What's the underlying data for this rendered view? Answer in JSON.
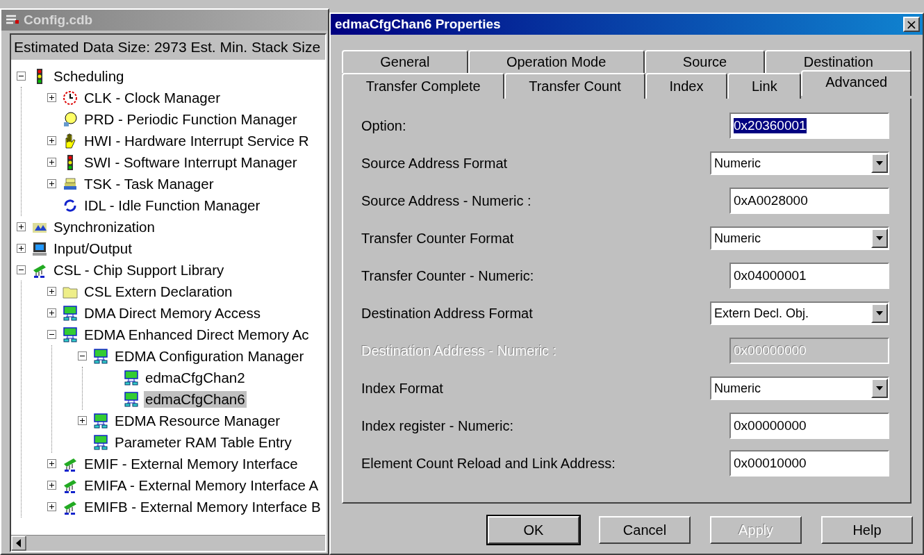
{
  "main_window": {
    "title": "Config.cdb",
    "status": "Estimated Data Size: 2973   Est. Min. Stack Size",
    "tree": [
      {
        "label": "Scheduling",
        "kind": "traffic",
        "expanded": true,
        "selected": false,
        "children": [
          {
            "label": "CLK - Clock Manager",
            "kind": "clock",
            "expanded": false,
            "selected": false
          },
          {
            "label": "PRD - Periodic Function Manager",
            "kind": "bulb",
            "selected": false
          },
          {
            "label": "HWI - Hardware Interrupt Service R",
            "kind": "hand",
            "expanded": false,
            "selected": false
          },
          {
            "label": "SWI - Software Interrupt Manager",
            "kind": "traffic",
            "expanded": false,
            "selected": false
          },
          {
            "label": "TSK - Task Manager",
            "kind": "books",
            "expanded": false,
            "selected": false
          },
          {
            "label": "IDL - Idle Function Manager",
            "kind": "cycle",
            "selected": false
          }
        ]
      },
      {
        "label": "Synchronization",
        "kind": "sync",
        "expanded": false,
        "selected": false
      },
      {
        "label": "Input/Output",
        "kind": "computer",
        "expanded": false,
        "selected": false
      },
      {
        "label": "CSL - Chip Support Library",
        "kind": "chip",
        "expanded": true,
        "selected": false,
        "children": [
          {
            "label": "CSL Extern Declaration",
            "kind": "folder",
            "expanded": false,
            "selected": false
          },
          {
            "label": "DMA Direct Memory Access",
            "kind": "board",
            "expanded": false,
            "selected": false
          },
          {
            "label": "EDMA Enhanced Direct Memory Ac",
            "kind": "board",
            "expanded": true,
            "selected": false,
            "children": [
              {
                "label": "EDMA Configuration Manager",
                "kind": "board",
                "expanded": true,
                "selected": false,
                "children": [
                  {
                    "label": "edmaCfgChan2",
                    "kind": "board",
                    "selected": false
                  },
                  {
                    "label": "edmaCfgChan6",
                    "kind": "board",
                    "selected": true
                  }
                ]
              },
              {
                "label": "EDMA Resource Manager",
                "kind": "board",
                "expanded": false,
                "selected": false
              },
              {
                "label": "Parameter RAM Table Entry",
                "kind": "board",
                "selected": false
              }
            ]
          },
          {
            "label": "EMIF - External Memory Interface",
            "kind": "chip",
            "expanded": false,
            "selected": false
          },
          {
            "label": "EMIFA - External Memory Interface A",
            "kind": "chip",
            "expanded": false,
            "selected": false
          },
          {
            "label": "EMIFB - External Memory Interface B",
            "kind": "chip",
            "expanded": false,
            "selected": false
          }
        ]
      }
    ]
  },
  "dialog": {
    "title": "edmaCfgChan6 Properties",
    "close": "×",
    "tab_rows": [
      [
        {
          "label": "General",
          "selected": false
        },
        {
          "label": "Operation Mode",
          "selected": false
        },
        {
          "label": "Source",
          "selected": false
        },
        {
          "label": "Destination",
          "selected": false
        }
      ],
      [
        {
          "label": "Transfer Complete",
          "selected": false
        },
        {
          "label": "Transfer Count",
          "selected": false
        },
        {
          "label": "Index",
          "selected": false
        },
        {
          "label": "Link",
          "selected": false
        },
        {
          "label": "Advanced",
          "selected": true
        }
      ]
    ],
    "fields": [
      {
        "label": "Option:",
        "kind": "text",
        "value": "0x20360001",
        "highlighted": true,
        "disabled": false
      },
      {
        "label": "Source Address Format",
        "kind": "select",
        "value": "Numeric",
        "disabled": false
      },
      {
        "label": "Source Address - Numeric :",
        "kind": "text",
        "value": "0xA0028000",
        "highlighted": false,
        "disabled": false
      },
      {
        "label": "Transfer Counter Format",
        "kind": "select",
        "value": "Numeric",
        "disabled": false
      },
      {
        "label": "Transfer Counter - Numeric:",
        "kind": "text",
        "value": "0x04000001",
        "highlighted": false,
        "disabled": false
      },
      {
        "label": "Destination Address Format",
        "kind": "select",
        "value": "Extern Decl. Obj.",
        "disabled": false
      },
      {
        "label": "Destination Address - Numeric :",
        "kind": "text",
        "value": "0x00000000",
        "highlighted": false,
        "disabled": true
      },
      {
        "label": "Index Format",
        "kind": "select",
        "value": "Numeric",
        "disabled": false
      },
      {
        "label": "Index register - Numeric:",
        "kind": "text",
        "value": "0x00000000",
        "highlighted": false,
        "disabled": false
      },
      {
        "label": "Element Count Reload and Link Address:",
        "kind": "text",
        "value": "0x00010000",
        "highlighted": false,
        "disabled": false
      }
    ],
    "buttons": [
      {
        "label": "OK",
        "default": true,
        "disabled": false
      },
      {
        "label": "Cancel",
        "default": false,
        "disabled": false
      },
      {
        "label": "Apply",
        "default": false,
        "disabled": true
      },
      {
        "label": "Help",
        "default": false,
        "disabled": false
      }
    ]
  }
}
